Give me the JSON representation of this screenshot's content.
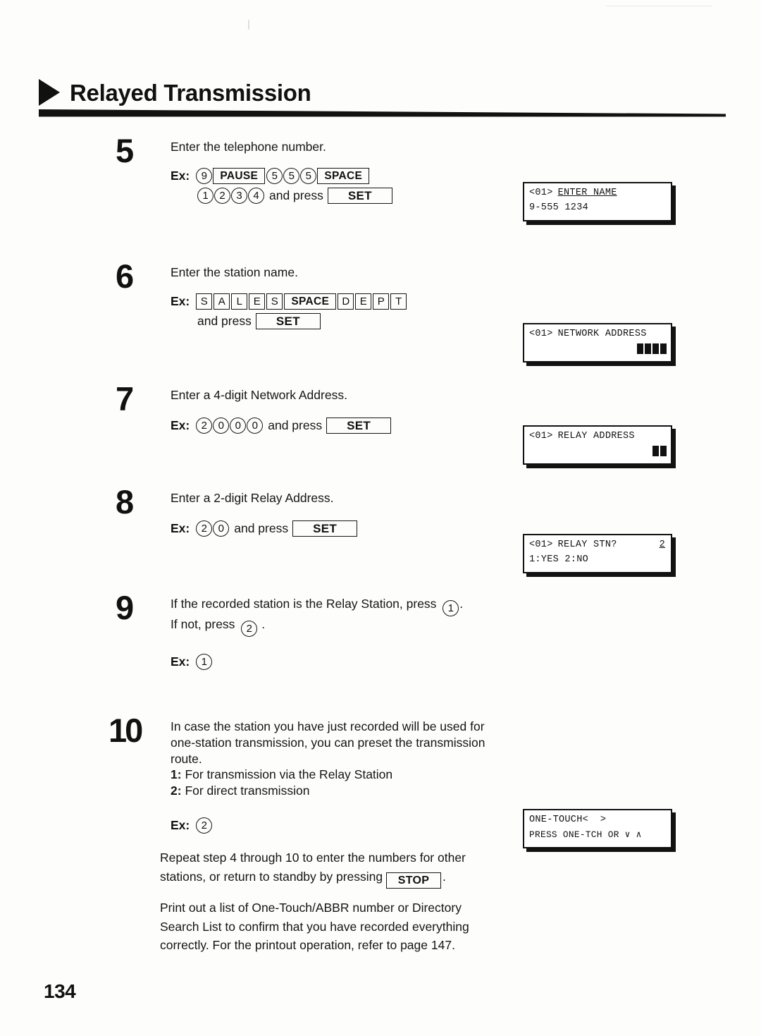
{
  "document": {
    "title": "Relayed Transmission",
    "page_number": "134",
    "marker_icon": "triangle-right-icon"
  },
  "steps": [
    {
      "number": "5",
      "instruction": "Enter the telephone number.",
      "ex_label": "Ex:",
      "keys_line1": [
        {
          "type": "circle",
          "label": "9"
        },
        {
          "type": "wide",
          "label": "PAUSE"
        },
        {
          "type": "circle",
          "label": "5"
        },
        {
          "type": "circle",
          "label": "5"
        },
        {
          "type": "circle",
          "label": "5"
        },
        {
          "type": "wide",
          "label": "SPACE"
        }
      ],
      "keys_line2": [
        {
          "type": "circle",
          "label": "1"
        },
        {
          "type": "circle",
          "label": "2"
        },
        {
          "type": "circle",
          "label": "3"
        },
        {
          "type": "circle",
          "label": "4"
        },
        {
          "type": "text",
          "label": "and press"
        },
        {
          "type": "set",
          "label": "SET"
        }
      ]
    },
    {
      "number": "6",
      "instruction": "Enter the station name.",
      "ex_label": "Ex:",
      "keys_line1": [
        {
          "type": "box",
          "label": "S"
        },
        {
          "type": "box",
          "label": "A"
        },
        {
          "type": "box",
          "label": "L"
        },
        {
          "type": "box",
          "label": "E"
        },
        {
          "type": "box",
          "label": "S"
        },
        {
          "type": "wide",
          "label": "SPACE"
        },
        {
          "type": "box",
          "label": "D"
        },
        {
          "type": "box",
          "label": "E"
        },
        {
          "type": "box",
          "label": "P"
        },
        {
          "type": "box",
          "label": "T"
        }
      ],
      "keys_line2": [
        {
          "type": "text",
          "label": "and press"
        },
        {
          "type": "set",
          "label": "SET"
        }
      ]
    },
    {
      "number": "7",
      "instruction": "Enter a 4-digit Network Address.",
      "ex_label": "Ex:",
      "keys_line1": [
        {
          "type": "circle",
          "label": "2"
        },
        {
          "type": "circle",
          "label": "0"
        },
        {
          "type": "circle",
          "label": "0"
        },
        {
          "type": "circle",
          "label": "0"
        },
        {
          "type": "text",
          "label": "and press"
        },
        {
          "type": "set",
          "label": "SET"
        }
      ],
      "keys_line2": []
    },
    {
      "number": "8",
      "instruction": "Enter a 2-digit Relay Address.",
      "ex_label": "Ex:",
      "keys_line1": [
        {
          "type": "circle",
          "label": "2"
        },
        {
          "type": "circle",
          "label": "0"
        },
        {
          "type": "text",
          "label": "and press"
        },
        {
          "type": "set",
          "label": "SET"
        }
      ],
      "keys_line2": []
    }
  ],
  "step9": {
    "number": "9",
    "line1_pre": "If the recorded station is the Relay Station, press",
    "line1_key": "1",
    "line1_post": ".",
    "line2_pre": "If not, press",
    "line2_key": "2",
    "line2_post": ".",
    "ex_label": "Ex:",
    "ex_key": "1"
  },
  "step10": {
    "number": "10",
    "body": "In case the station you have just recorded will be used for one-station transmission, you can preset the transmission route.",
    "option1_num": "1:",
    "option1_text": "For transmission via the Relay Station",
    "option2_num": "2:",
    "option2_text": "For direct transmission",
    "ex_label": "Ex:",
    "ex_key": "2"
  },
  "closing": {
    "repeat_pre": "Repeat step 4 through 10 to enter the numbers for other stations, or return to standby by pressing",
    "repeat_key": "STOP",
    "repeat_post": ".",
    "printout": "Print out a list of One-Touch/ABBR number or Directory Search List to confirm that you have recorded everything correctly.  For the printout operation, refer to page 147."
  },
  "lcds": [
    {
      "id": "lcd-enter-name",
      "line1_left": "<01>",
      "line1_right": "ENTER NAME",
      "line1_underline": true,
      "line2": "9-555 1234",
      "blocks": 0
    },
    {
      "id": "lcd-network-address",
      "line1_left": "<01>",
      "line1_right": "NETWORK ADDRESS",
      "line1_underline": false,
      "line2": "",
      "blocks": 4
    },
    {
      "id": "lcd-relay-address",
      "line1_left": "<01>",
      "line1_right": "RELAY ADDRESS",
      "line1_underline": false,
      "line2": "",
      "blocks": 2
    },
    {
      "id": "lcd-relay-stn",
      "line1_left": "<01>",
      "line1_right": "RELAY STN?",
      "line1_value": "2",
      "line1_underline": false,
      "line2": "1:YES 2:NO",
      "blocks": 0
    },
    {
      "id": "lcd-one-touch",
      "line1_left": "ONE-TOUCH<  >",
      "line1_right": "",
      "line1_underline": false,
      "line2": "PRESS ONE-TCH OR ∨ ∧",
      "blocks": 0
    }
  ]
}
